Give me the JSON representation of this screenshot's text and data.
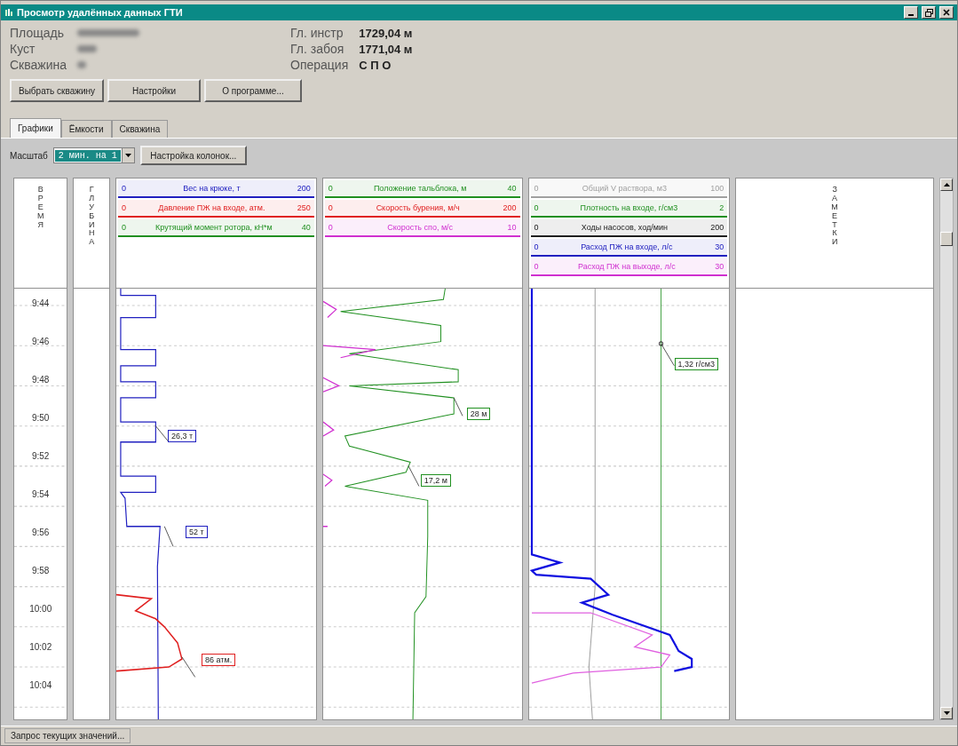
{
  "window": {
    "title": "Просмотр удалённых данных ГТИ"
  },
  "well_info": [
    {
      "label": "Площадь"
    },
    {
      "label": "Куст"
    },
    {
      "label": "Скважина"
    }
  ],
  "depth_info": [
    {
      "label": "Гл. инстр",
      "value": "1729,04 м"
    },
    {
      "label": "Гл. забоя",
      "value": "1771,04 м"
    },
    {
      "label": "Операция",
      "value": "С П О"
    }
  ],
  "buttons": [
    "Выбрать скважину",
    "Настройки",
    "О программе..."
  ],
  "tabs": [
    {
      "label": "Графики",
      "selected": true
    },
    {
      "label": "Ёмкости",
      "selected": false
    },
    {
      "label": "Скважина",
      "selected": false
    }
  ],
  "toolbar": {
    "scale_label": "Масштаб",
    "scale_value": "2 мин. на 1",
    "columns_button": "Настройка колонок..."
  },
  "time_column": {
    "title": "ВРЕМЯ",
    "times": [
      "9:44",
      "9:46",
      "9:48",
      "9:50",
      "9:52",
      "9:54",
      "9:56",
      "9:58",
      "10:00",
      "10:02",
      "10:04"
    ]
  },
  "depth_column": {
    "title": "ГЛУБИНА"
  },
  "tracks": [
    {
      "params": [
        {
          "min": "0",
          "label": "Вес на крюке, т",
          "max": "200",
          "color": "#2020c0"
        },
        {
          "min": "0",
          "label": "Давление ПЖ на входе, атм.",
          "max": "250",
          "color": "#e02020"
        },
        {
          "min": "0",
          "label": "Крутящий момент ротора, кН*м",
          "max": "40",
          "color": "#209020"
        }
      ],
      "callouts": [
        {
          "text": "26,3 т",
          "color": "#2020c0"
        },
        {
          "text": "52 т",
          "color": "#2020c0"
        },
        {
          "text": "86 атм.",
          "color": "#e02020"
        }
      ]
    },
    {
      "params": [
        {
          "min": "0",
          "label": "Положение тальблока, м",
          "max": "40",
          "color": "#209020"
        },
        {
          "min": "0",
          "label": "Скорость бурения, м/ч",
          "max": "200",
          "color": "#e02020"
        },
        {
          "min": "0",
          "label": "Скорость спо, м/с",
          "max": "10",
          "color": "#d030d0"
        }
      ],
      "callouts": [
        {
          "text": "28 м",
          "color": "#209020"
        },
        {
          "text": "17,2 м",
          "color": "#209020"
        }
      ]
    },
    {
      "params": [
        {
          "min": "0",
          "label": "Общий V раствора, м3",
          "max": "100",
          "color": "#a0a0a0"
        },
        {
          "min": "0",
          "label": "Плотность на входе, г/см3",
          "max": "2",
          "color": "#209020"
        },
        {
          "min": "0",
          "label": "Ходы насосов, ход/мин",
          "max": "200",
          "color": "#202020"
        },
        {
          "min": "0",
          "label": "Расход ПЖ на входе, л/с",
          "max": "30",
          "color": "#2020c0"
        },
        {
          "min": "0",
          "label": "Расход ПЖ на выходе, л/с",
          "max": "30",
          "color": "#d030d0"
        }
      ],
      "callouts": [
        {
          "text": "1,32 г/см3",
          "color": "#209020"
        }
      ]
    }
  ],
  "notes_column": {
    "title": "ЗАМЕТКИ"
  },
  "status_bar": "Запрос текущих значений..."
}
